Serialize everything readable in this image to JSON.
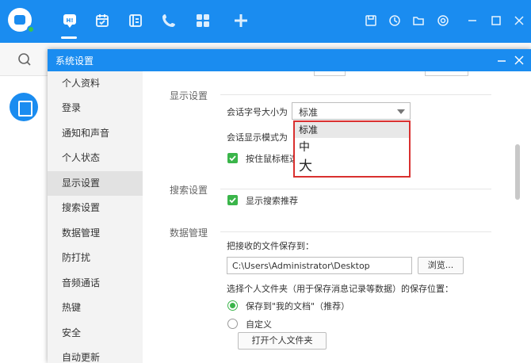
{
  "dialog": {
    "title": "系统设置"
  },
  "sidebar": {
    "items": [
      "个人资料",
      "登录",
      "通知和声音",
      "个人状态",
      "显示设置",
      "搜索设置",
      "数据管理",
      "防打扰",
      "音频通话",
      "热键",
      "安全",
      "自动更新"
    ],
    "active": "显示设置"
  },
  "display": {
    "section_title": "显示设置",
    "font_size_label": "会话字号大小为",
    "font_size_value": "标准",
    "display_mode_label": "会话显示模式为",
    "hover_checkbox_label": "按住鼠标框选"
  },
  "font_size_dropdown": {
    "options": [
      "标准",
      "中",
      "大"
    ],
    "selected": "标准"
  },
  "search": {
    "section_title": "搜索设置",
    "recommend_label": "显示搜索推荐"
  },
  "data": {
    "section_title": "数据管理",
    "save_to_label": "把接收的文件保存到：",
    "save_path": "C:\\Users\\Administrator\\Desktop",
    "browse_button": "浏览...",
    "personal_folder_label": "选择个人文件夹（用于保存消息记录等数据）的保存位置：",
    "option_my_docs": "保存到\"我的文档\"（推荐）",
    "option_custom": "自定义",
    "open_folder_button": "打开个人文件夹"
  },
  "icons": {
    "app": "app-logo-icon",
    "nav": [
      "chat-icon",
      "calendar-icon",
      "contacts-icon",
      "phone-icon",
      "apps-grid-icon",
      "plus-icon"
    ],
    "window": [
      "save-icon",
      "history-icon",
      "folder-icon",
      "settings-icon",
      "minimize-icon",
      "maximize-icon",
      "close-icon"
    ]
  },
  "colors": {
    "accent": "#1a8cf0",
    "check": "#3ab54a",
    "highlight": "#d9302f"
  }
}
